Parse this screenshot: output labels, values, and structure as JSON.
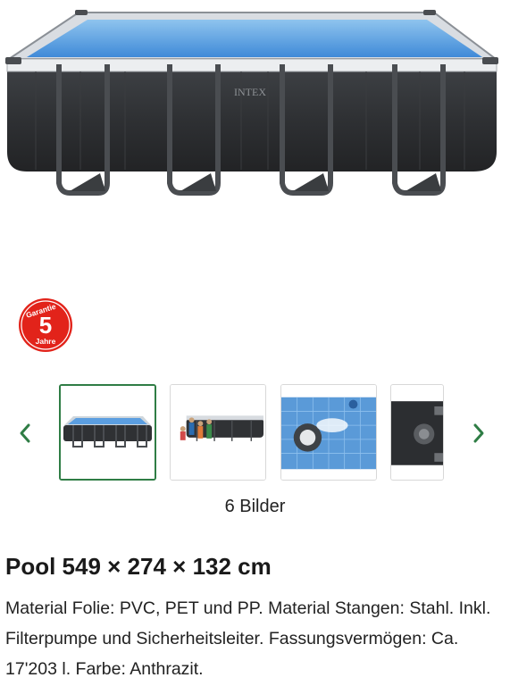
{
  "product": {
    "brand_print": "INTEX",
    "title": "Pool 549 × 274 × 132 cm",
    "description": "Material Folie: PVC, PET und PP. Material Stangen: Stahl. Inkl. Filterpumpe und Sicherheitsleiter. Fassungsvermögen: Ca. 17'203 l. Farbe: Anthrazit."
  },
  "badge": {
    "top_text": "Garantie",
    "number": "5",
    "bottom_text": "Jahre",
    "color": "#e2231a"
  },
  "gallery": {
    "prev_icon": "chevron-left-icon",
    "next_icon": "chevron-right-icon",
    "count_label": "6 Bilder",
    "accent_color": "#2f7d45"
  }
}
